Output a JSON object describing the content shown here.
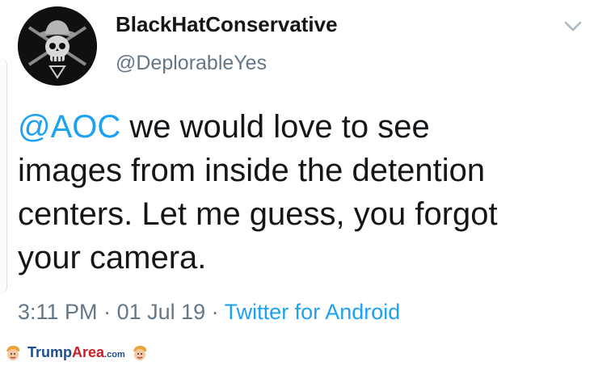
{
  "tweet": {
    "author": {
      "display_name": "BlackHatConservative",
      "handle": "@DeplorableYes"
    },
    "text": {
      "mention": "@AOC",
      "line1_rest": " we would love to see",
      "line2": "images from inside the detention",
      "line3": "centers. Let me guess, you forgot",
      "line4": "your camera."
    },
    "meta": {
      "time": "3:11 PM",
      "separator1": " · ",
      "date": "01 Jul 19",
      "separator2": " · ",
      "source": "Twitter for Android"
    },
    "menu_icon": "chevron-down-icon"
  },
  "watermark": {
    "part1": "Trump",
    "part2": "Area",
    "part3": ".com"
  },
  "colors": {
    "link": "#1da1f2",
    "meta": "#657786",
    "text": "#14171a"
  }
}
